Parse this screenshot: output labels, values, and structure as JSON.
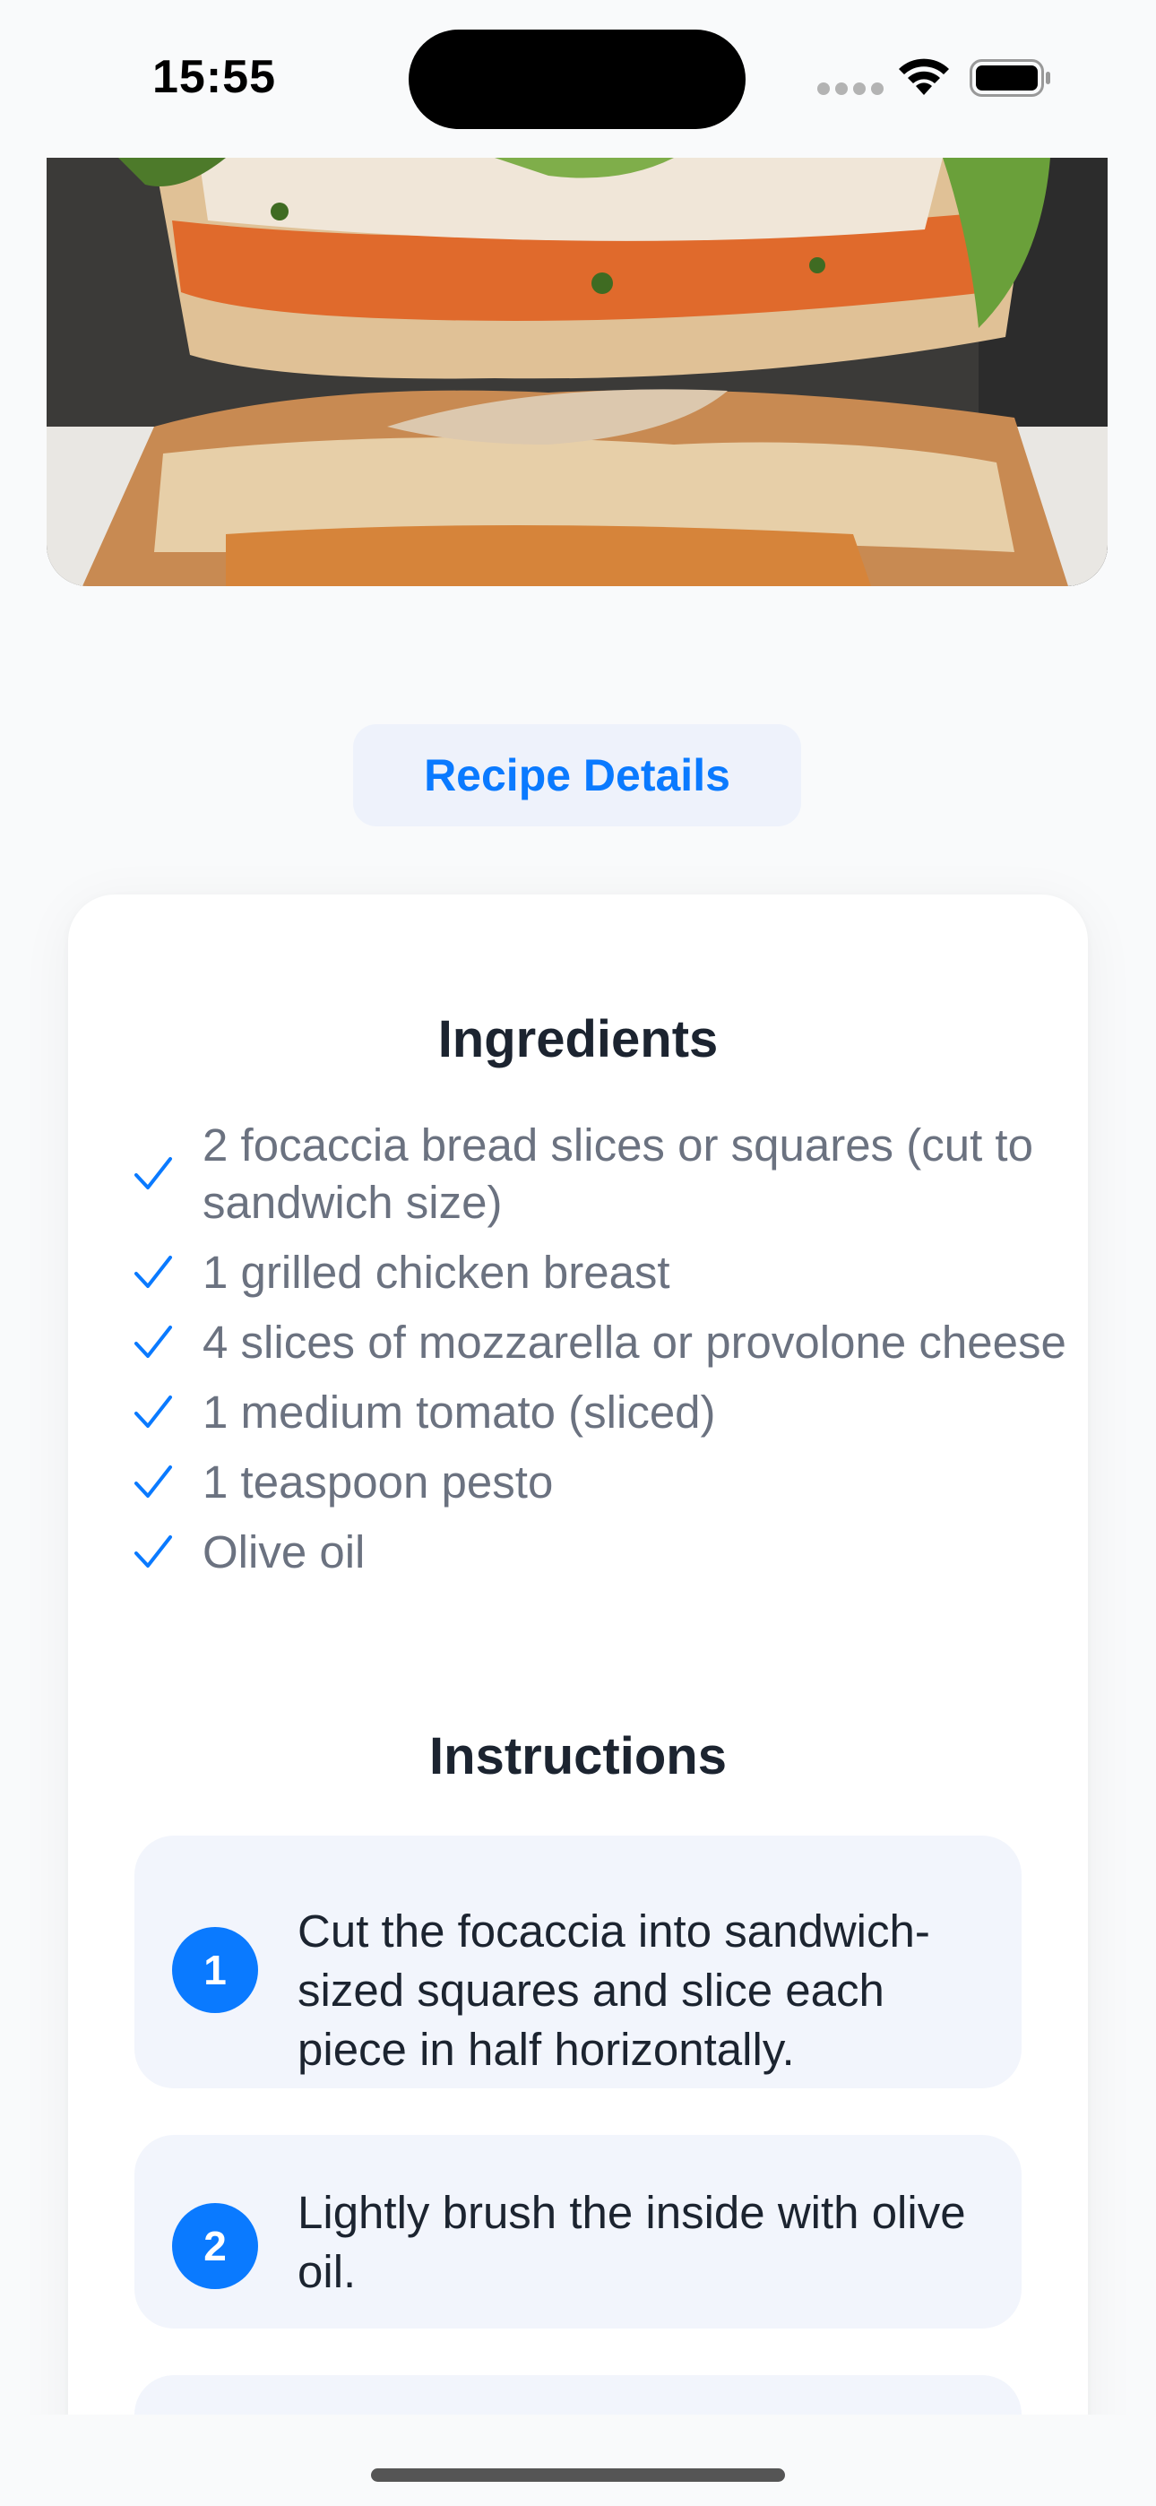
{
  "status_bar": {
    "time": "15:55"
  },
  "hero_image": {
    "subject": "stacked focaccia chicken sandwich"
  },
  "details_button": {
    "label": "Recipe Details"
  },
  "ingredients": {
    "title": "Ingredients",
    "items": [
      "2 focaccia bread slices or squares (cut to sandwich size)",
      "1 grilled chicken breast",
      "4 slices of mozzarella or provolone cheese",
      "1 medium tomato (sliced)",
      "1 teaspoon pesto",
      "Olive oil"
    ]
  },
  "instructions": {
    "title": "Instructions",
    "steps": [
      {
        "number": "1",
        "text": "Cut the focaccia into sandwich-sized squares and slice each piece in half horizontally."
      },
      {
        "number": "2",
        "text": "Lightly brush the inside with olive oil."
      }
    ]
  },
  "colors": {
    "accent": "#0a7aff",
    "heading": "#1c2430",
    "muted_text": "#6b7280",
    "step_background": "#f2f5fc"
  },
  "icons": [
    "wifi-icon",
    "battery-icon",
    "check-icon"
  ]
}
